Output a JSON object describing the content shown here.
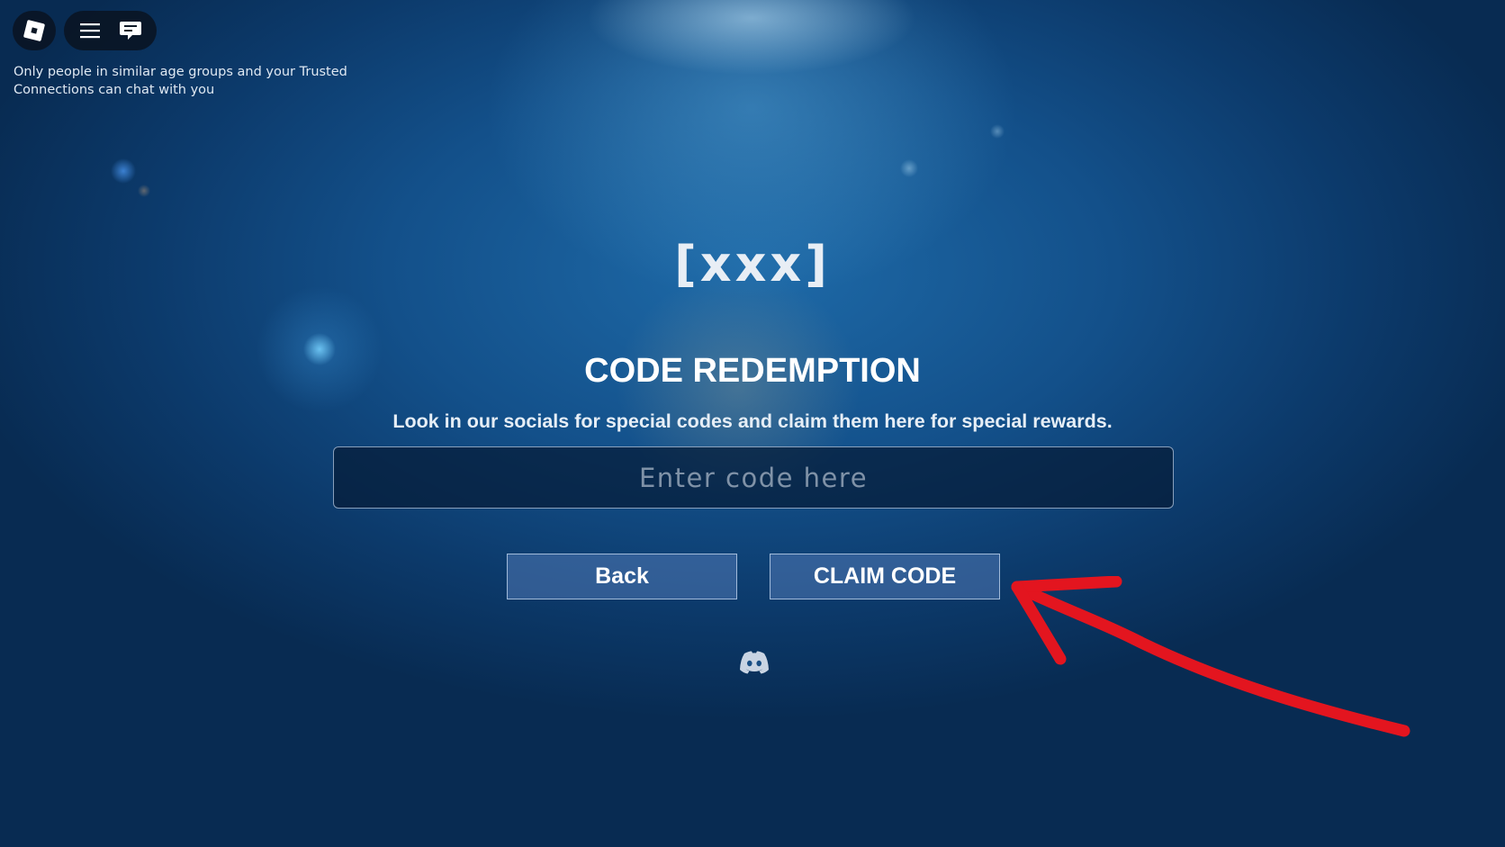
{
  "topbar": {
    "roblox_menu_icon": "roblox-logo-icon",
    "menu_icon": "hamburger-menu-icon",
    "chat_icon": "chat-icon",
    "notice": "Only people in similar age groups and your Trusted Connections can chat with you"
  },
  "panel": {
    "logo_text": "[xxx]",
    "title": "CODE REDEMPTION",
    "subtitle": "Look in our socials for special codes and claim them here for special rewards.",
    "code_input": {
      "value": "",
      "placeholder": "Enter code here"
    },
    "back_label": "Back",
    "claim_label": "CLAIM CODE",
    "social_icon": "discord-icon"
  },
  "annotation": {
    "arrow_color": "#e3151f"
  },
  "colors": {
    "background_deep": "#0c3a6b",
    "button_fill": "#4f78b4",
    "text": "#ffffff"
  }
}
